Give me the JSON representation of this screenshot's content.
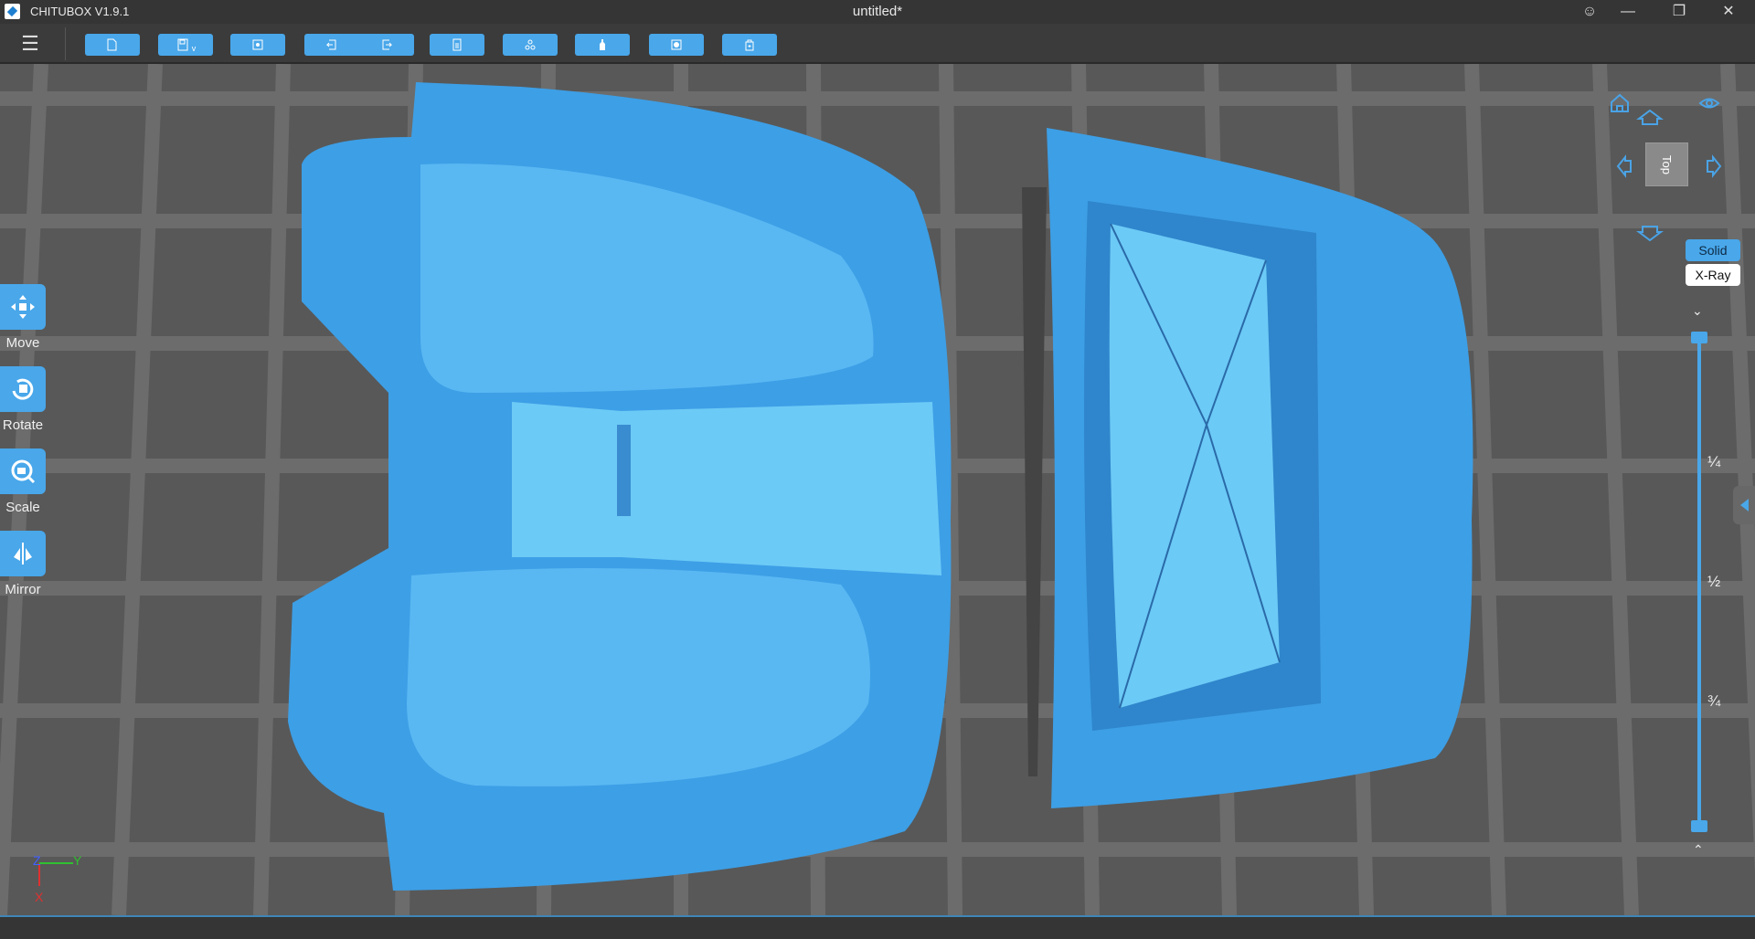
{
  "titlebar": {
    "app_name": "CHITUBOX V1.9.1",
    "document_title": "untitled*",
    "buttons": [
      "user",
      "minimize",
      "restore",
      "close"
    ]
  },
  "toolbar": {
    "buttons": [
      {
        "name": "open-file",
        "icon": "folder-icon"
      },
      {
        "name": "save",
        "icon": "save-icon"
      },
      {
        "name": "auto-layout",
        "icon": "layout-icon"
      },
      {
        "name": "undo",
        "icon": "undo-icon"
      },
      {
        "name": "redo",
        "icon": "redo-icon"
      },
      {
        "name": "print-settings",
        "icon": "document-icon"
      },
      {
        "name": "group",
        "icon": "group-icon"
      },
      {
        "name": "support",
        "icon": "bottle-icon"
      },
      {
        "name": "hollow",
        "icon": "hollow-icon"
      },
      {
        "name": "slice",
        "icon": "slice-icon"
      }
    ]
  },
  "tools": [
    {
      "label": "Move"
    },
    {
      "label": "Rotate"
    },
    {
      "label": "Scale"
    },
    {
      "label": "Mirror"
    }
  ],
  "view": {
    "cube_face": "Top",
    "solid_label": "Solid",
    "xray_label": "X-Ray",
    "active_mode": "Solid"
  },
  "slider": {
    "marks": [
      "¼",
      "½",
      "¾"
    ],
    "upper_value": 1.0,
    "lower_value": 0.0
  },
  "axes": {
    "z": "Z",
    "y": "Y",
    "x": "X"
  },
  "colors": {
    "accent": "#49a7ea",
    "model": "#3d9fe6",
    "background": "#585858"
  }
}
